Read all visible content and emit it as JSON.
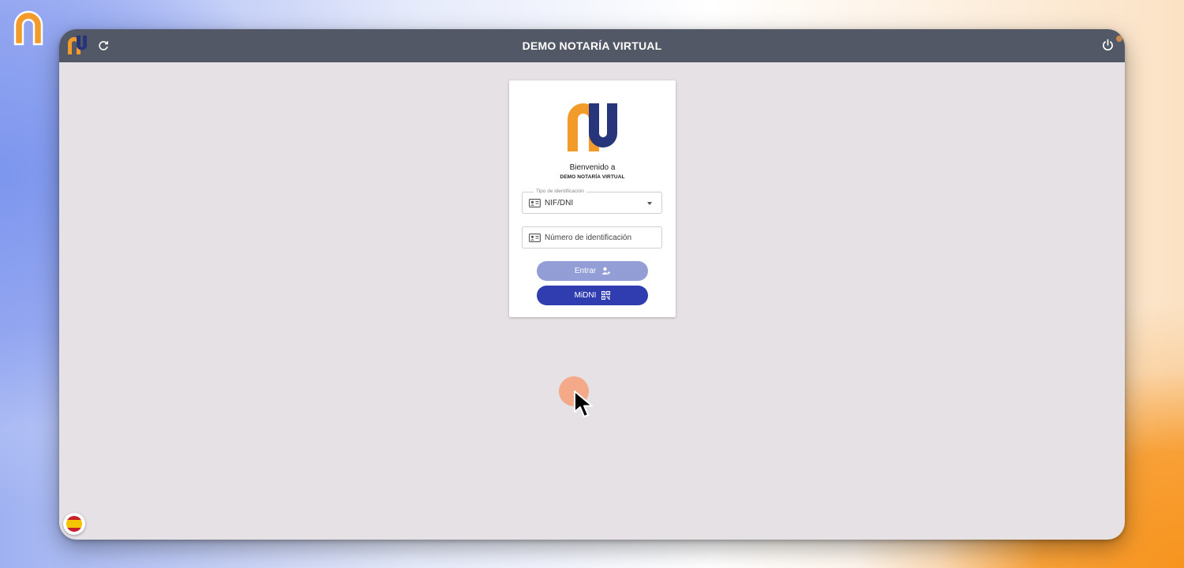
{
  "app": {
    "title": "DEMO NOTARÍA VIRTUAL",
    "brand_colors": {
      "orange": "#f39b2a",
      "navy": "#27357a",
      "topbar": "#525865",
      "primary_button": "#2f3db0",
      "disabled_button": "#949ed6"
    }
  },
  "topbar": {
    "refresh_icon": "refresh-icon",
    "power_icon": "power-icon"
  },
  "login": {
    "welcome": "Bienvenido a",
    "notary_name": "DEMO NOTARÍA VIRTUAL",
    "id_type": {
      "label": "Tipo de identificación",
      "selected": "NIF/DNI",
      "icon": "id-card-icon"
    },
    "id_number": {
      "placeholder": "Número de identificación",
      "value": "",
      "icon": "id-card-icon"
    },
    "enter_button": {
      "label": "Entrar",
      "icon": "person-add-icon",
      "disabled": true
    },
    "midni_button": {
      "label": "MiDNI",
      "icon": "qr-code-icon"
    }
  },
  "language": {
    "selected": "es",
    "icon": "spain-flag-icon"
  }
}
